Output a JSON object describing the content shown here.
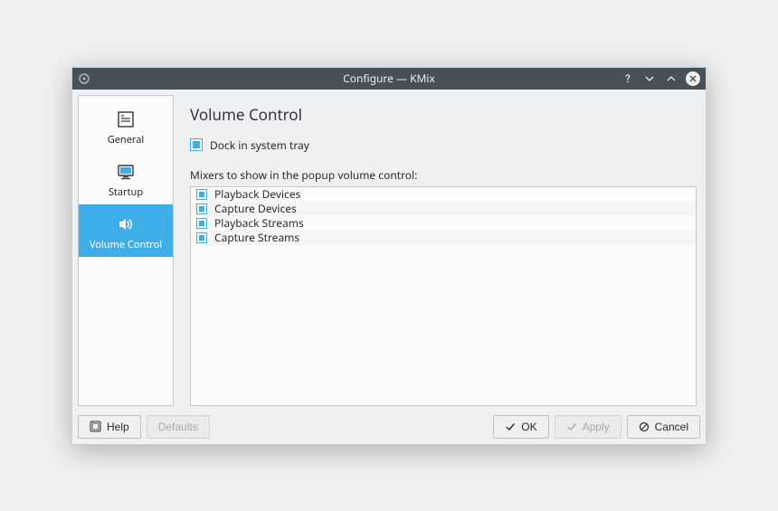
{
  "window": {
    "title": "Configure — KMix"
  },
  "sidebar": {
    "items": [
      {
        "label": "General",
        "iconId": "general-icon"
      },
      {
        "label": "Startup",
        "iconId": "startup-icon"
      },
      {
        "label": "Volume Control",
        "iconId": "volume-icon"
      }
    ],
    "activeIndex": 2
  },
  "page": {
    "title": "Volume Control",
    "dockLabel": "Dock in system tray",
    "dockChecked": true,
    "mixersLabel": "Mixers to show in the popup volume control:",
    "mixers": [
      {
        "label": "Playback Devices",
        "checked": true
      },
      {
        "label": "Capture Devices",
        "checked": true
      },
      {
        "label": "Playback Streams",
        "checked": true
      },
      {
        "label": "Capture Streams",
        "checked": true
      }
    ]
  },
  "buttons": {
    "help": "Help",
    "defaults": "Defaults",
    "ok": "OK",
    "apply": "Apply",
    "cancel": "Cancel"
  }
}
